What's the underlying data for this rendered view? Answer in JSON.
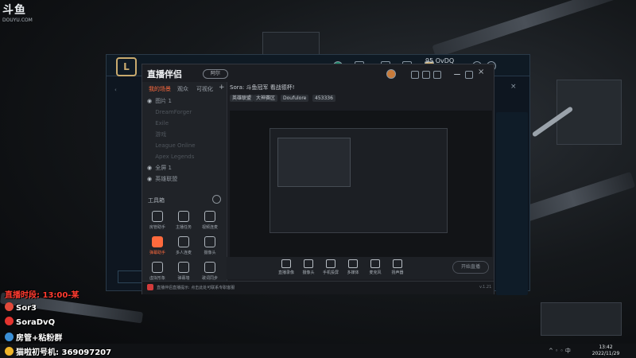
{
  "watermark": {
    "logo": "斗鱼",
    "domain": "DOUYU.COM"
  },
  "game_client": {
    "user_tag": "OvDQ",
    "user_tag_number": "95"
  },
  "stream_app": {
    "title": "直播伴侣",
    "badge": "阿尔",
    "sidebar_tabs": [
      "我的场景",
      "观众",
      "可视化"
    ],
    "scenes": [
      {
        "label": "图片 1",
        "visible": true
      },
      {
        "label": "DreamForger",
        "visible": false
      },
      {
        "label": "Exile",
        "visible": false
      },
      {
        "label": "游戏",
        "visible": false
      },
      {
        "label": "League Online",
        "visible": false
      },
      {
        "label": "Apex Legends",
        "visible": false
      },
      {
        "label": "全屏 1",
        "visible": true
      },
      {
        "label": "英雄联盟",
        "visible": true
      }
    ],
    "tools_title": "工具箱",
    "tools": [
      {
        "label": "房管助手",
        "hot": false
      },
      {
        "label": "主播任务",
        "hot": false
      },
      {
        "label": "视频连麦",
        "hot": false
      },
      {
        "label": "弹幕助手",
        "hot": true
      },
      {
        "label": "多人连麦",
        "hot": false
      },
      {
        "label": "摄像头",
        "hot": false
      },
      {
        "label": "虚拟形象",
        "hot": false
      },
      {
        "label": "弹幕墙",
        "hot": false
      },
      {
        "label": "歌词同步",
        "hot": false
      }
    ],
    "room_title": "Sora: 斗鱼冠军 看战德杯!",
    "chips": [
      "英雄联盟",
      "大神赛区",
      "Doufulore",
      "453336"
    ],
    "bottom_tools": [
      "直播录像",
      "摄像头",
      "手机投屏",
      "多媒体",
      "麦克风",
      "扬声器"
    ],
    "go_live": "开始直播",
    "status_message": "直播伴侣直播提示: 点击此处可联系专职客服",
    "version": "v.1.21"
  },
  "overlay": {
    "schedule": "直播时段: 13:00-某",
    "lines": [
      {
        "icon": "douyu-icon",
        "text": "Sor3"
      },
      {
        "icon": "weibo-icon",
        "text": "SoraDvQ"
      },
      {
        "icon": "qq-icon",
        "text": "房管+粘粉群"
      },
      {
        "icon": "fan-icon",
        "text": "猫啦初号机: 369097207"
      }
    ]
  },
  "taskbar": {
    "time": "13:42",
    "date": "2022/11/29"
  },
  "colors": {
    "accent": "#ff6a3d",
    "schedule_red": "#ff3b30",
    "game_gold": "#c8aa6e"
  }
}
